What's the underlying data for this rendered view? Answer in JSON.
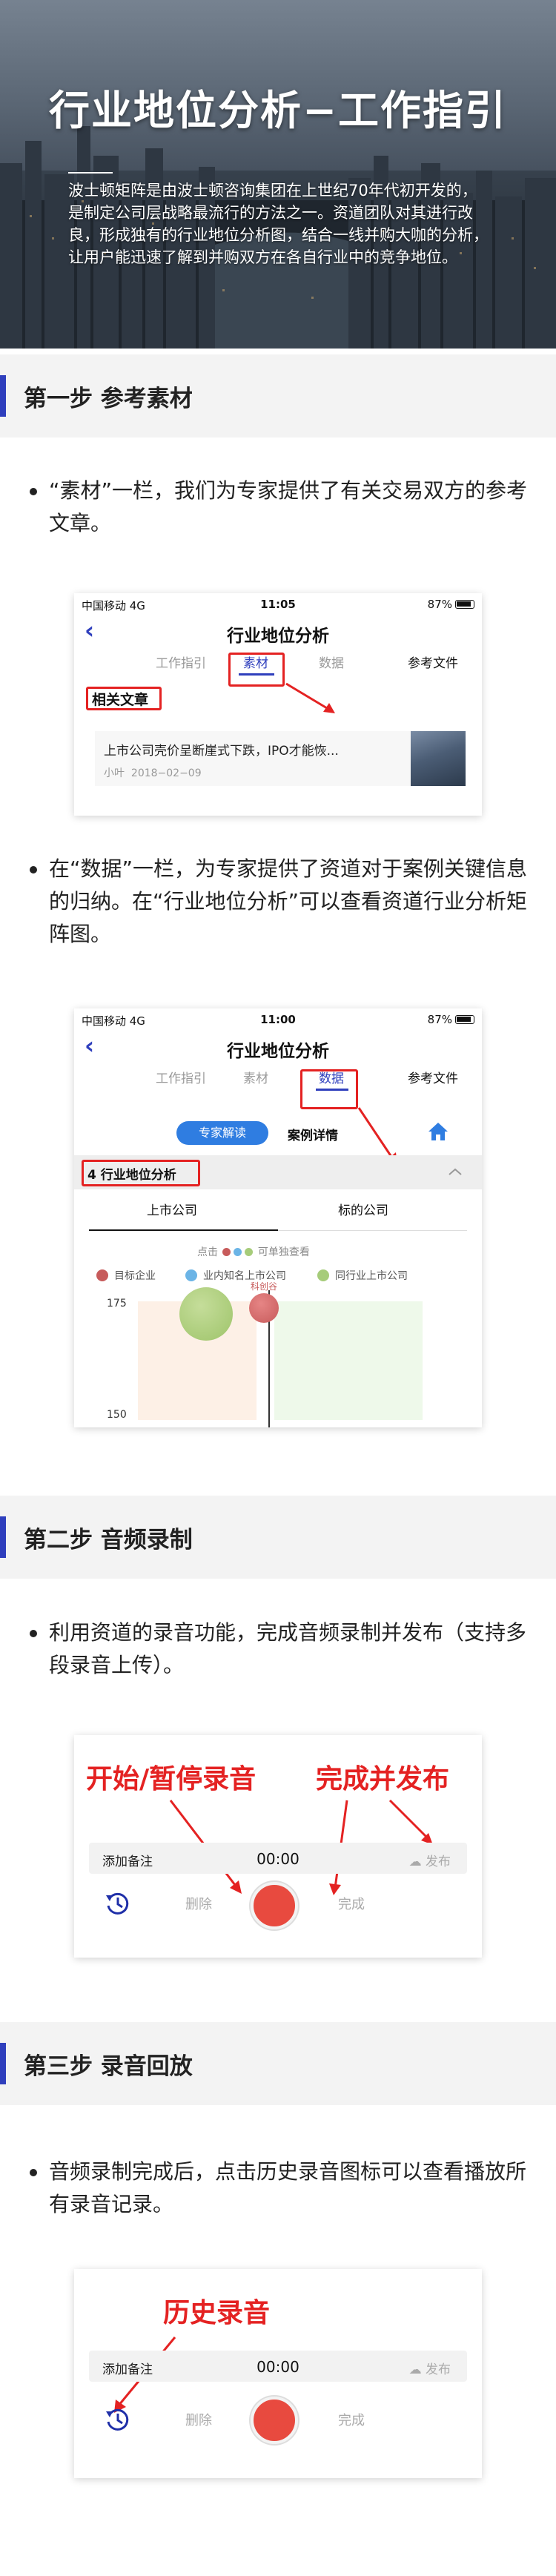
{
  "hero": {
    "title": "行业地位分析−工作指引",
    "intro": "波士顿矩阵是由波士顿咨询集团在上世纪70年代初开发的，是制定公司层战略最流行的方法之一。资道团队对其进行改良，形成独有的行业地位分析图，结合一线并购大咖的分析，让用户能迅速了解到并购双方在各自行业中的竞争地位。"
  },
  "steps": [
    {
      "label": "第一步 参考素材"
    },
    {
      "label": "第二步 音频录制"
    },
    {
      "label": "第三步 录音回放"
    }
  ],
  "bullets": [
    "“素材”一栏，我们为专家提供了有关交易双方的参考文章。",
    "在“数据”一栏，为专家提供了资道对于案例关键信息的归纳。在“行业地位分析”可以查看资道行业分析矩阵图。",
    "利用资道的录音功能，完成音频录制并发布（支持多段录音上传）。",
    "音频录制完成后，点击历史录音图标可以查看播放所有录音记录。"
  ],
  "phone1": {
    "status": {
      "carrier": "中国移动  4G",
      "time": "11:05",
      "battery": "87%"
    },
    "title": "行业地位分析",
    "tabs": [
      "工作指引",
      "素材",
      "数据",
      "参考文件"
    ],
    "section": "相关文章",
    "article": {
      "title": "上市公司壳价呈断崖式下跌，IPO才能恢...",
      "source": "小叶",
      "date": "2018−02−09"
    }
  },
  "phone2": {
    "status": {
      "carrier": "中国移动  4G",
      "time": "11:00",
      "battery": "87%"
    },
    "title": "行业地位分析",
    "tabs": [
      "工作指引",
      "素材",
      "数据",
      "参考文件"
    ],
    "buttons": {
      "expert": "专家解读",
      "case": "案例详情"
    },
    "section": "4 行业地位分析",
    "subtabs": [
      "上市公司",
      "标的公司"
    ],
    "hint_pre": "点击",
    "hint_post": "可单独查看",
    "legend": [
      "目标企业",
      "业内知名上市公司",
      "同行业上市公司"
    ],
    "bubble_label": "科创谷",
    "y_ticks": [
      "175",
      "150"
    ]
  },
  "recorder": {
    "note": "添加备注",
    "time": "00:00",
    "publish": "发布",
    "delete": "删除",
    "complete": "完成"
  },
  "callouts": {
    "start_pause": "开始/暂停录音",
    "finish_publish": "完成并发布",
    "history": "历史录音"
  },
  "colors": {
    "accent": "#2f3fbd",
    "highlight": "#e42222",
    "record": "#e84a3f",
    "target": "#c75b5b",
    "known": "#6bb4e6",
    "peer": "#a6cc7a"
  }
}
